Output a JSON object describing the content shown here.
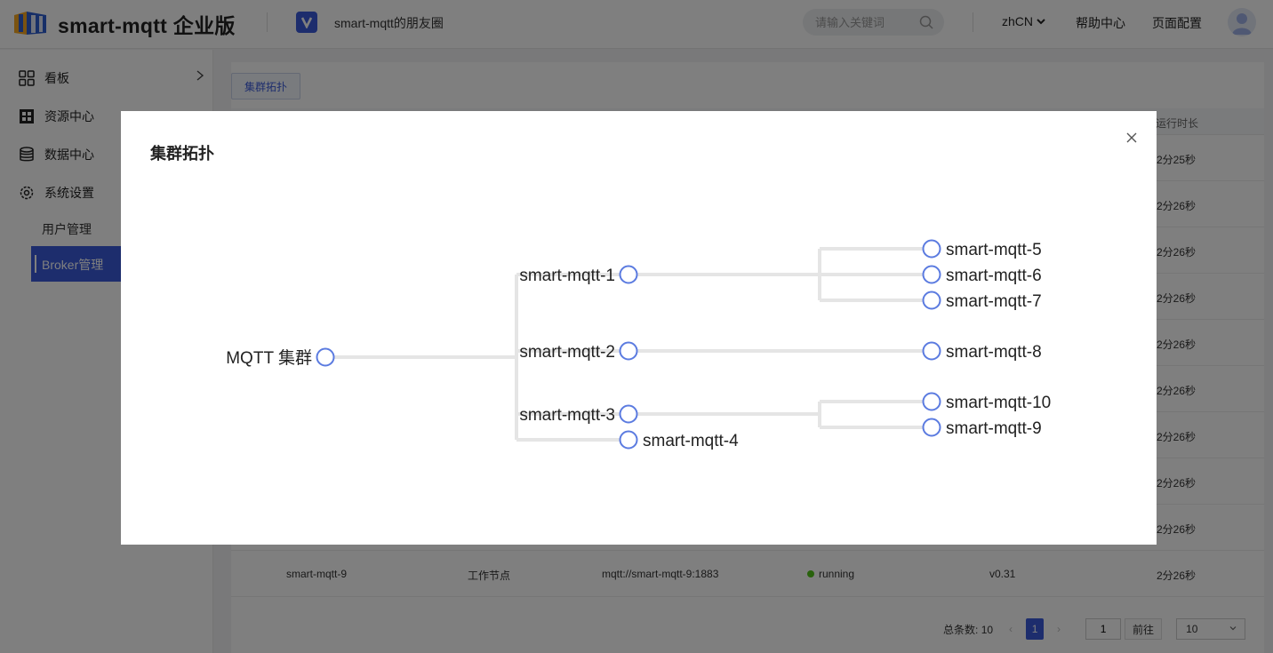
{
  "header": {
    "brand": "smart-mqtt 企业版",
    "friend_link": "smart-mqtt的朋友圈",
    "search_placeholder": "请输入关键词",
    "language": "zhCN",
    "help": "帮助中心",
    "page_config": "页面配置"
  },
  "sidebar": {
    "items": [
      {
        "label": "看板",
        "icon": "dashboard-icon"
      },
      {
        "label": "资源中心",
        "icon": "resource-icon"
      },
      {
        "label": "数据中心",
        "icon": "database-icon"
      },
      {
        "label": "系统设置",
        "icon": "gear-icon"
      }
    ],
    "sub_items": [
      {
        "label": "用户管理"
      },
      {
        "label": "Broker管理",
        "active": true
      }
    ]
  },
  "content": {
    "tag_button": "集群拓扑",
    "column_runtime": "运行时长",
    "durations": [
      "2分25秒",
      "2分26秒",
      "2分26秒",
      "2分26秒",
      "2分26秒",
      "2分26秒",
      "2分26秒",
      "2分26秒",
      "2分26秒"
    ],
    "last_row": {
      "name": "smart-mqtt-9",
      "role": "工作节点",
      "address": "mqtt://smart-mqtt-9:1883",
      "status": "running",
      "version": "v0.31",
      "duration": "2分26秒"
    },
    "pagination": {
      "total_label": "总条数:",
      "total": "10",
      "current_page": "1",
      "jump_value": "1",
      "go_label": "前往",
      "page_size": "10"
    }
  },
  "modal": {
    "title": "集群拓扑",
    "tree": {
      "root": "MQTT 集群",
      "level1": [
        "smart-mqtt-1",
        "smart-mqtt-2",
        "smart-mqtt-3"
      ],
      "level2": [
        "smart-mqtt-5",
        "smart-mqtt-6",
        "smart-mqtt-7",
        "smart-mqtt-8",
        "smart-mqtt-10",
        "smart-mqtt-9",
        "smart-mqtt-4"
      ]
    }
  },
  "colors": {
    "accent": "#3b5bdb",
    "node_stroke": "#5b7be0",
    "link": "#e5e5e5",
    "running": "#52c41a"
  }
}
